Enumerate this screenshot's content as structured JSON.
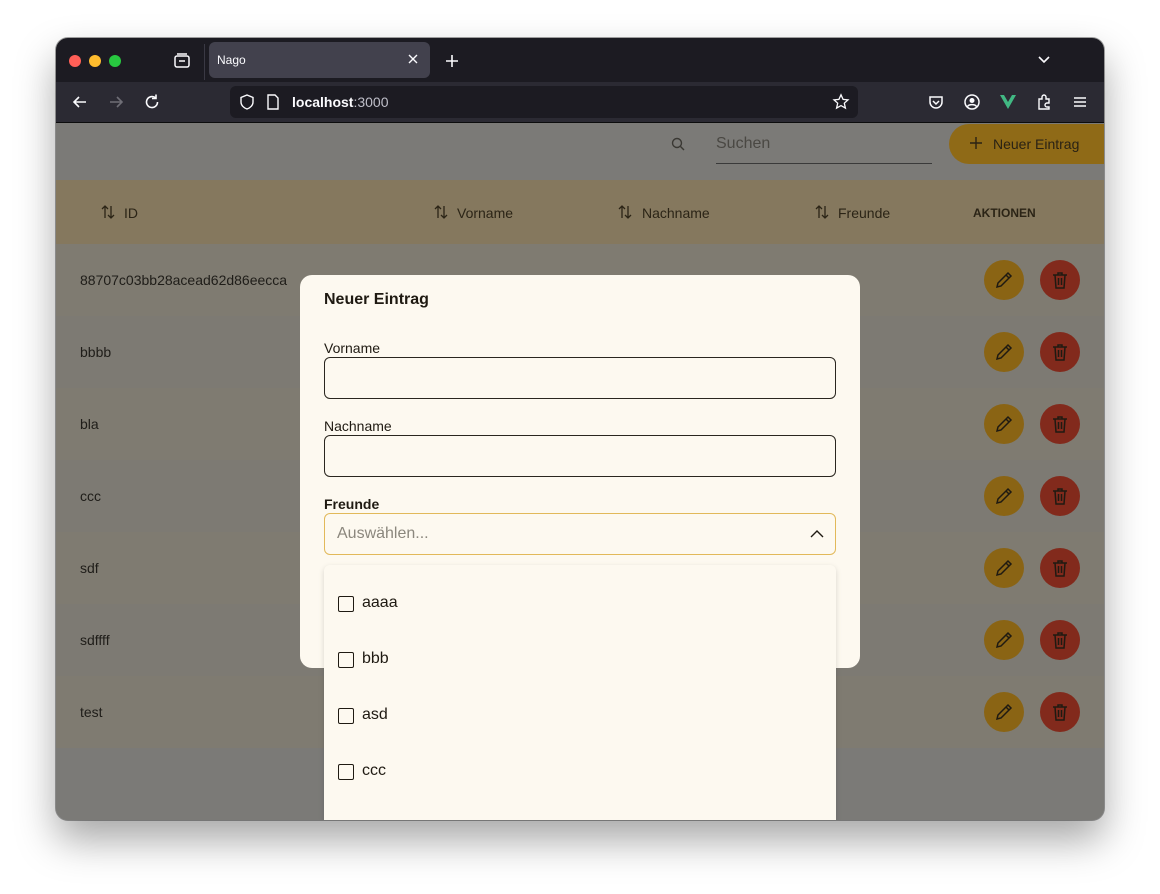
{
  "browser": {
    "tab_title": "Nago",
    "url_host": "localhost",
    "url_port": ":3000"
  },
  "toolbar": {
    "search_placeholder": "Suchen",
    "new_entry_label": "Neuer Eintrag"
  },
  "table": {
    "columns": [
      "ID",
      "Vorname",
      "Nachname",
      "Freunde",
      "AKTIONEN"
    ],
    "rows": [
      {
        "id": "88707c03bb28acead62d86eecca"
      },
      {
        "id": "bbbb"
      },
      {
        "id": "bla"
      },
      {
        "id": "ccc"
      },
      {
        "id": "sdf"
      },
      {
        "id": "sdffff"
      },
      {
        "id": "test"
      }
    ]
  },
  "modal": {
    "title": "Neuer Eintrag",
    "first_name_label": "Vorname",
    "last_name_label": "Nachname",
    "friends_label": "Freunde",
    "friends_placeholder": "Auswählen..."
  },
  "dropdown": {
    "options": [
      "aaaa",
      "bbb",
      "asd",
      "ccc"
    ]
  },
  "colors": {
    "accent": "#e8a91f",
    "danger": "#c23a26"
  }
}
